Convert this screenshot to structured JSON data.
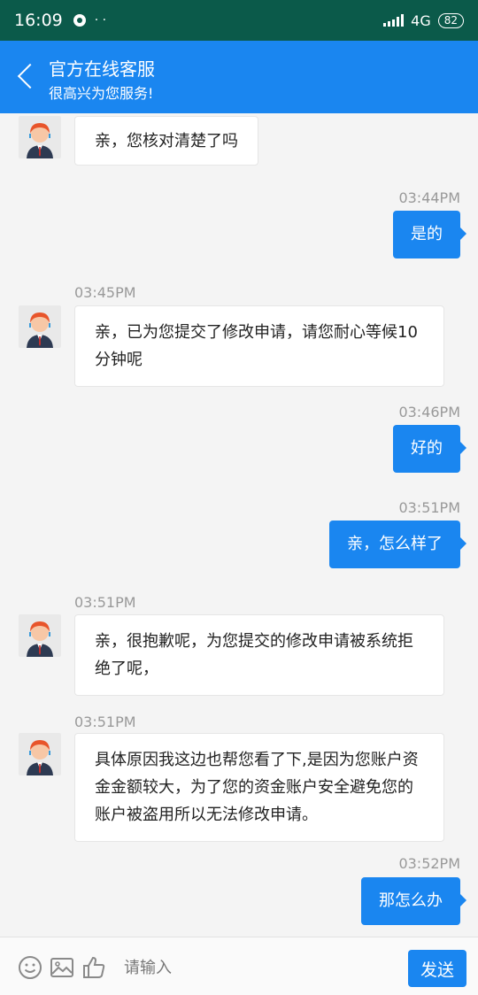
{
  "status_bar": {
    "time": "16:09",
    "network": "4G",
    "battery": "82"
  },
  "header": {
    "title": "官方在线客服",
    "subtitle": "很高兴为您服务!"
  },
  "messages": [
    {
      "sender": "agent",
      "text": "亲，您核对清楚了吗"
    },
    {
      "sender": "user",
      "time": "03:44PM",
      "text": "是的"
    },
    {
      "sender": "agent",
      "time": "03:45PM",
      "lines": [
        "亲，已为您提交了修改申请，请您耐心等候10",
        "分钟呢"
      ]
    },
    {
      "sender": "user",
      "time": "03:46PM",
      "text": "好的"
    },
    {
      "sender": "user",
      "time": "03:51PM",
      "text": "亲，怎么样了"
    },
    {
      "sender": "agent",
      "time": "03:51PM",
      "lines": [
        "亲，很抱歉呢，为您提交的修改申请被系统拒",
        "绝了呢，"
      ]
    },
    {
      "sender": "agent",
      "time": "03:51PM",
      "lines": [
        "具体原因我这边也帮您看了下,是因为您账户资",
        "金金额较大，为了您的资金账户安全避免您的",
        "账户被盗用所以无法修改申请。"
      ]
    },
    {
      "sender": "user",
      "time": "03:52PM",
      "text": "那怎么办"
    }
  ],
  "input_bar": {
    "placeholder": "请输入",
    "send_label": "发送",
    "icons": [
      "emoji-icon",
      "image-icon",
      "thumbs-up-icon"
    ]
  },
  "colors": {
    "status_bar": "#0b5a4a",
    "accent": "#1a86f0",
    "background": "#f4f4f4"
  }
}
